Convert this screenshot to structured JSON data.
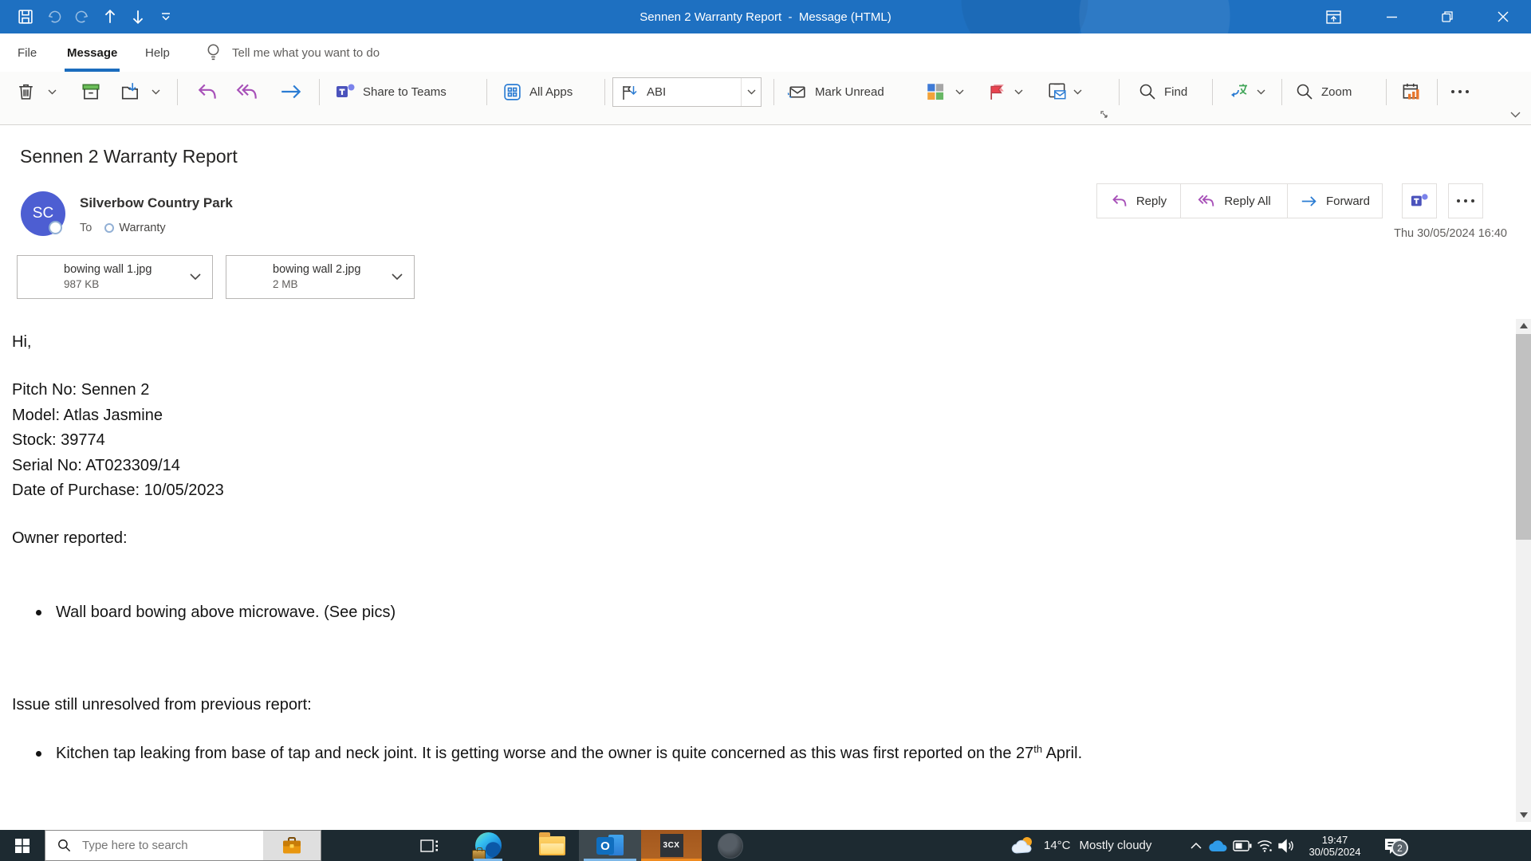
{
  "window": {
    "title": "Sennen 2 Warranty Report  -  Message (HTML)"
  },
  "ribbon": {
    "tabs": {
      "file": "File",
      "message": "Message",
      "help": "Help"
    },
    "tell_me": "Tell me what you want to do",
    "share_to_teams": "Share to Teams",
    "all_apps": "All Apps",
    "quick_step": "ABI",
    "mark_unread": "Mark Unread",
    "find": "Find",
    "zoom": "Zoom"
  },
  "message": {
    "subject": "Sennen 2 Warranty Report",
    "sender": {
      "name": "Silverbow Country Park",
      "initials": "SC"
    },
    "to_label": "To",
    "recipient": "Warranty",
    "sent": "Thu 30/05/2024 16:40",
    "actions": {
      "reply": "Reply",
      "reply_all": "Reply All",
      "forward": "Forward"
    },
    "attachments": [
      {
        "name": "bowing wall 1.jpg",
        "size": "987 KB"
      },
      {
        "name": "bowing wall 2.jpg",
        "size": "2 MB"
      }
    ],
    "body": {
      "greeting": "Hi,",
      "details": [
        "Pitch No: Sennen 2",
        "Model: Atlas Jasmine",
        "Stock: 39774",
        "Serial No: AT023309/14",
        "Date of Purchase: 10/05/2023"
      ],
      "owner_heading": "Owner reported:",
      "bullet1": "Wall board bowing above microwave. (See pics)",
      "issue_heading": "Issue still unresolved from previous report:",
      "bullet2_pre": "Kitchen tap leaking from base of tap and neck joint. It is getting worse and the owner is quite concerned as this was first reported on the 27",
      "bullet2_sup": "th",
      "bullet2_post": " April."
    }
  },
  "taskbar": {
    "search_placeholder": "Type here to search",
    "outlook_letter": "O",
    "threecx_label": "3CX",
    "weather": {
      "temp": "14°C",
      "condition": "Mostly cloudy"
    },
    "clock": {
      "time": "19:47",
      "date": "30/05/2024"
    },
    "notifications_badge": "2"
  },
  "colors": {
    "titlebar_blue": "#1e70c1",
    "accent_blue": "#1b6dbe",
    "avatar_blue": "#4d5ed2",
    "reply_purple": "#a750b8",
    "forward_blue": "#2b7cd3",
    "flag_red": "#e8434f",
    "taskbar_dark": "#1d2a31",
    "threecx_orange": "#f08b1f"
  }
}
